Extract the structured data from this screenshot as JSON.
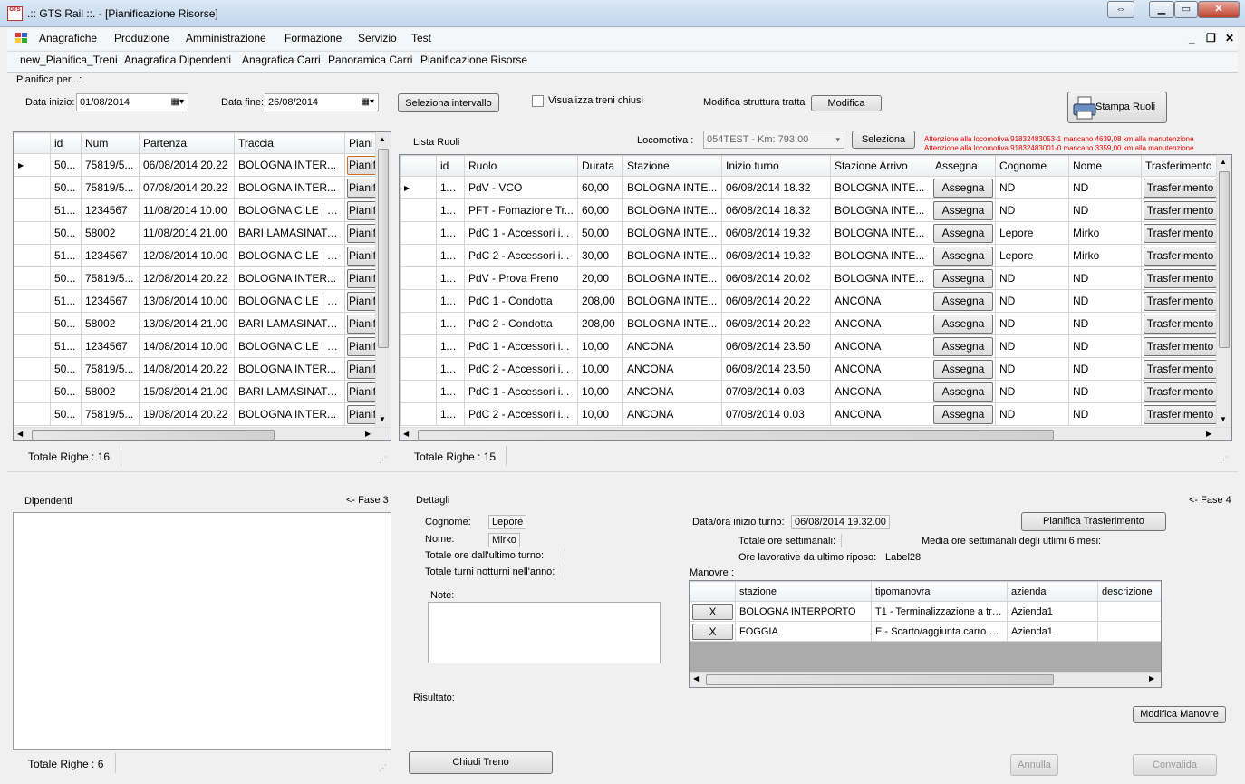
{
  "window": {
    "app_icon": "GTS",
    "title": ".:: GTS Rail ::. - [Pianificazione Risorse]"
  },
  "menu": [
    "Anagrafiche",
    "Produzione",
    "Amministrazione",
    "Formazione",
    "Servizio",
    "Test"
  ],
  "toolbar": [
    "new_Pianifica_Treni",
    "Anagrafica Dipendenti",
    "Anagrafica Carri",
    "Panoramica Carri",
    "Pianificazione Risorse"
  ],
  "filters": {
    "group_label": "Pianifica per...:",
    "start_label": "Data inizio:",
    "start_value": "01/08/2014",
    "end_label": "Data fine:",
    "end_value": "26/08/2014",
    "select_range_button": "Seleziona intervallo",
    "show_closed_label": "Visualizza treni chiusi",
    "modify_structure_label": "Modifica struttura tratta",
    "modify_button": "Modifica",
    "print_button": "Stampa Ruoli"
  },
  "trains": {
    "columns": [
      "id",
      "Num",
      "Partenza",
      "Traccia",
      "Piani"
    ],
    "rows": [
      [
        "50...",
        "75819/5...",
        "06/08/2014 20.22",
        "BOLOGNA INTER...",
        "Pianif"
      ],
      [
        "50...",
        "75819/5...",
        "07/08/2014 20.22",
        "BOLOGNA INTER...",
        "Pianif"
      ],
      [
        "51...",
        "1234567",
        "11/08/2014 10.00",
        "BOLOGNA C.LE | A...",
        "Pianif"
      ],
      [
        "50...",
        "58002",
        "11/08/2014 21.00",
        "BARI LAMASINATA ...",
        "Pianif"
      ],
      [
        "51...",
        "1234567",
        "12/08/2014 10.00",
        "BOLOGNA C.LE | A...",
        "Pianif"
      ],
      [
        "50...",
        "75819/5...",
        "12/08/2014 20.22",
        "BOLOGNA INTER...",
        "Pianif"
      ],
      [
        "51...",
        "1234567",
        "13/08/2014 10.00",
        "BOLOGNA C.LE | A...",
        "Pianif"
      ],
      [
        "50...",
        "58002",
        "13/08/2014 21.00",
        "BARI LAMASINATA ...",
        "Pianif"
      ],
      [
        "51...",
        "1234567",
        "14/08/2014 10.00",
        "BOLOGNA C.LE | A...",
        "Pianif"
      ],
      [
        "50...",
        "75819/5...",
        "14/08/2014 20.22",
        "BOLOGNA INTER...",
        "Pianif"
      ],
      [
        "50...",
        "58002",
        "15/08/2014 21.00",
        "BARI LAMASINATA ...",
        "Pianif"
      ],
      [
        "50...",
        "75819/5...",
        "19/08/2014 20.22",
        "BOLOGNA INTER...",
        "Pianif"
      ]
    ],
    "total": "Totale Righe : 16"
  },
  "roles": {
    "title": "Lista Ruoli",
    "loco_label": "Locomotiva :",
    "loco_value": "054TEST - Km: 793,00",
    "select_button": "Seleziona",
    "warning_1": "Attenzione alla locomotiva 91832483053-1 mancano 4639,08 km alla manutenzione",
    "warning_2": "Attenzione alla locomotiva 91832483001-0 mancano 3359,00 km alla manutenzione",
    "columns": [
      "id",
      "Ruolo",
      "Durata",
      "Stazione",
      "Inizio turno",
      "Stazione Arrivo",
      "Assegna",
      "Cognome",
      "Nome",
      "Trasferimento"
    ],
    "rows": [
      [
        "11...",
        "PdV - VCO",
        "60,00",
        "BOLOGNA INTE...",
        "06/08/2014 18.32",
        "BOLOGNA INTE...",
        "Assegna",
        "ND",
        "ND",
        "Trasferimento"
      ],
      [
        "11...",
        "PFT - Fomazione Tr...",
        "60,00",
        "BOLOGNA INTE...",
        "06/08/2014 18.32",
        "BOLOGNA INTE...",
        "Assegna",
        "ND",
        "ND",
        "Trasferimento"
      ],
      [
        "11...",
        "PdC 1 - Accessori i...",
        "50,00",
        "BOLOGNA INTE...",
        "06/08/2014 19.32",
        "BOLOGNA INTE...",
        "Assegna",
        "Lepore",
        "Mirko",
        "Trasferimento"
      ],
      [
        "11...",
        "PdC 2 - Accessori i...",
        "30,00",
        "BOLOGNA INTE...",
        "06/08/2014 19.32",
        "BOLOGNA INTE...",
        "Assegna",
        "Lepore",
        "Mirko",
        "Trasferimento"
      ],
      [
        "11...",
        "PdV - Prova Freno",
        "20,00",
        "BOLOGNA INTE...",
        "06/08/2014 20.02",
        "BOLOGNA INTE...",
        "Assegna",
        "ND",
        "ND",
        "Trasferimento"
      ],
      [
        "11...",
        "PdC 1 - Condotta",
        "208,00",
        "BOLOGNA INTE...",
        "06/08/2014 20.22",
        "ANCONA",
        "Assegna",
        "ND",
        "ND",
        "Trasferimento"
      ],
      [
        "11...",
        "PdC 2 - Condotta",
        "208,00",
        "BOLOGNA INTE...",
        "06/08/2014 20.22",
        "ANCONA",
        "Assegna",
        "ND",
        "ND",
        "Trasferimento"
      ],
      [
        "11...",
        "PdC 1 - Accessori i...",
        "10,00",
        "ANCONA",
        "06/08/2014 23.50",
        "ANCONA",
        "Assegna",
        "ND",
        "ND",
        "Trasferimento"
      ],
      [
        "11...",
        "PdC 2 - Accessori i...",
        "10,00",
        "ANCONA",
        "06/08/2014 23.50",
        "ANCONA",
        "Assegna",
        "ND",
        "ND",
        "Trasferimento"
      ],
      [
        "11...",
        "PdC 1 - Accessori i...",
        "10,00",
        "ANCONA",
        "07/08/2014 0.03",
        "ANCONA",
        "Assegna",
        "ND",
        "ND",
        "Trasferimento"
      ],
      [
        "11...",
        "PdC 2 - Accessori i...",
        "10,00",
        "ANCONA",
        "07/08/2014 0.03",
        "ANCONA",
        "Assegna",
        "ND",
        "ND",
        "Trasferimento"
      ]
    ],
    "total": "Totale Righe : 15"
  },
  "employees": {
    "title": "Dipendenti",
    "phase": "<- Fase 3",
    "total": "Totale Righe : 6"
  },
  "details": {
    "title": "Dettagli",
    "phase": "<- Fase 4",
    "surname_label": "Cognome:",
    "surname_value": "Lepore",
    "name_label": "Nome:",
    "name_value": "Mirko",
    "hours_since_label": "Totale ore dall'ultimo turno:",
    "night_shifts_label": "Totale turni notturni nell'anno:",
    "notes_label": "Note:",
    "result_label": "Risultato:",
    "shift_start_label": "Data/ora inizio turno:",
    "shift_start_value": "06/08/2014 19.32.00",
    "plan_transfer_button": "Pianifica Trasferimento",
    "weekly_hours_label": "Totale ore settimanali:",
    "avg_weekly_label": "Media ore settimanali degli utlimi 6 mesi:",
    "hours_since_rest_label": "Ore lavorative da ultimo riposo:",
    "hours_since_rest_value": "Label28",
    "maneuvers_label": "Manovre :",
    "maneuvers_columns": [
      "",
      "stazione",
      "tipomanovra",
      "azienda",
      "descrizione"
    ],
    "maneuvers_rows": [
      [
        "X",
        "BOLOGNA INTERPORTO",
        "T1 - Terminalizzazione a tre...",
        "Azienda1",
        ""
      ],
      [
        "X",
        "FOGGIA",
        "E - Scarto/aggiunta carro o ...",
        "Azienda1",
        ""
      ]
    ],
    "modify_maneuvers_button": "Modifica Manovre",
    "close_train_button": "Chiudi Treno",
    "cancel_button": "Annulla",
    "validate_button": "Convalida"
  }
}
